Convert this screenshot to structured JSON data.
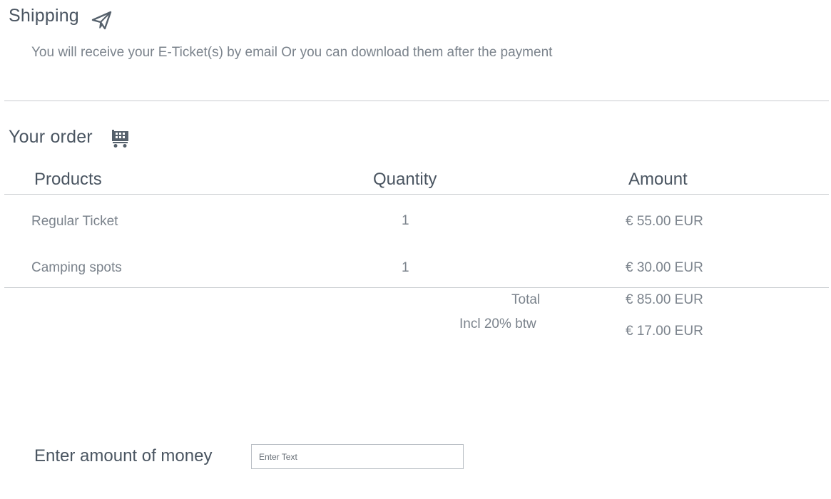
{
  "shipping": {
    "title": "Shipping",
    "message": "You will receive your E-Ticket(s) by email Or you can download them after the payment"
  },
  "order": {
    "title": "Your order",
    "columns": {
      "products": "Products",
      "quantity": "Quantity",
      "amount": "Amount"
    },
    "rows": [
      {
        "product": "Regular Ticket",
        "quantity": "1",
        "amount": "€ 55.00 EUR"
      },
      {
        "product": "Camping spots",
        "quantity": "1",
        "amount": "€ 30.00 EUR"
      }
    ],
    "total_label": "Total",
    "total_value": "€ 85.00 EUR",
    "vat_label": "Incl 20% btw",
    "vat_value": "€ 17.00 EUR"
  },
  "payment": {
    "label": "Enter amount of money",
    "input_placeholder": "Enter Text",
    "input_value": ""
  },
  "icons": {
    "shipping": "paper-plane-icon",
    "order": "shopping-cart-icon"
  },
  "colors": {
    "heading": "#4a5561",
    "body_text": "#7b838c",
    "divider": "#c9ccd0",
    "input_border": "#b9bec4"
  }
}
